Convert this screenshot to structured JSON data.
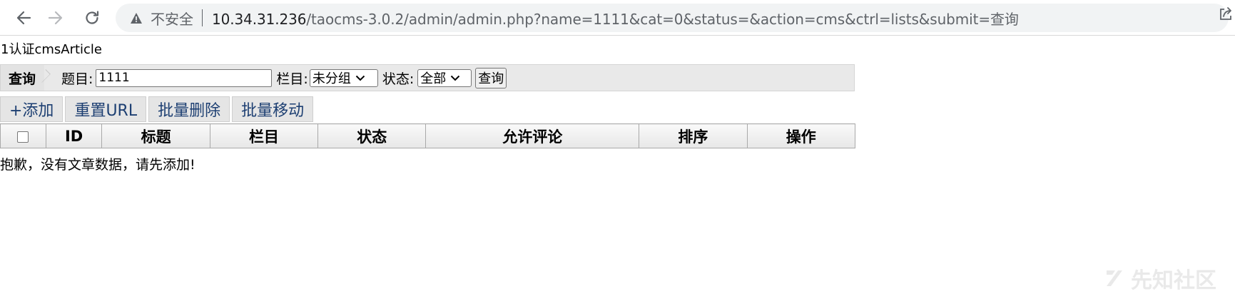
{
  "browser": {
    "insecure_label": "不安全",
    "url_host": "10.34.31.236",
    "url_path": "/taocms-3.0.2/admin/admin.php?name=1111&cat=0&status=&action=cms&ctrl=lists&submit=查询",
    "icons": {
      "back": "arrow-left-icon",
      "forward": "arrow-right-icon",
      "reload": "reload-icon",
      "warning": "warning-triangle-icon",
      "share": "share-icon"
    }
  },
  "page": {
    "title": "1认证cmsArticle",
    "search": {
      "tag": "查询",
      "title_label": "题目:",
      "title_value": "1111",
      "category_label": "栏目:",
      "category_selected": "未分组",
      "status_label": "状态:",
      "status_selected": "全部",
      "submit_label": "查询"
    },
    "toolbar": {
      "add": "+添加",
      "reset_url": "重置URL",
      "batch_delete": "批量删除",
      "batch_move": "批量移动"
    },
    "table": {
      "headers": [
        "ID",
        "标题",
        "栏目",
        "状态",
        "允许评论",
        "排序",
        "操作"
      ]
    },
    "empty_message": "抱歉，没有文章数据，请先添加!",
    "watermark": "先知社区"
  }
}
